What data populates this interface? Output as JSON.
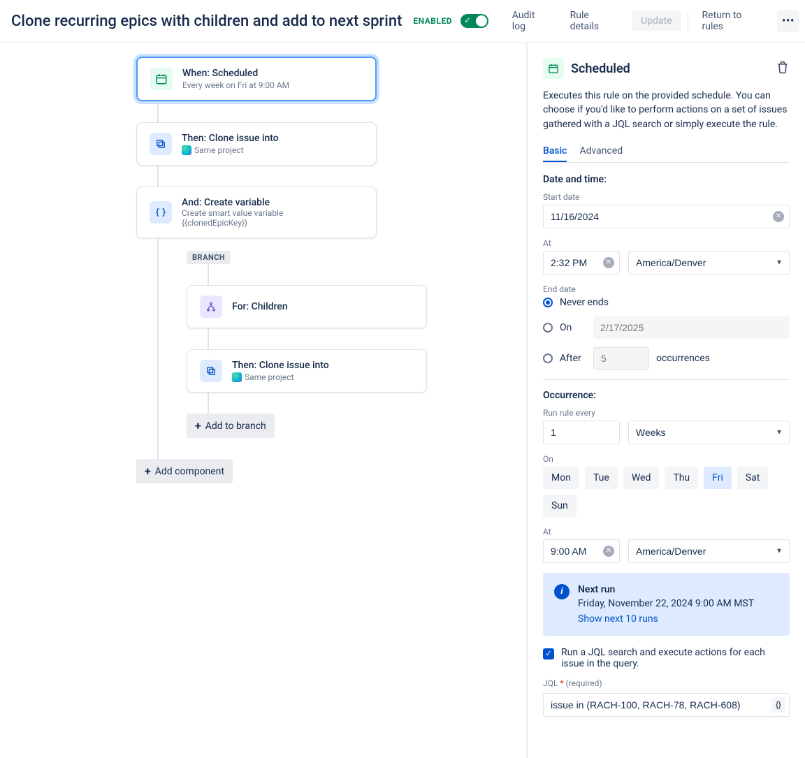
{
  "header": {
    "title": "Clone recurring epics with children and add to next sprint",
    "enabled_label": "ENABLED",
    "audit_log": "Audit log",
    "rule_details": "Rule details",
    "update": "Update",
    "return": "Return to rules",
    "more": "•••"
  },
  "nodes": {
    "trigger": {
      "title": "When: Scheduled",
      "sub": "Every week on Fri at 9:00 AM"
    },
    "clone1": {
      "title": "Then: Clone issue into",
      "sub": "Same project"
    },
    "var": {
      "title": "And: Create variable",
      "sub": "Create smart value variable",
      "sub2": "{{clonedEpicKey}}"
    },
    "branch_label": "BRANCH",
    "branch_for": {
      "title": "For: Children"
    },
    "clone2": {
      "title": "Then: Clone issue into",
      "sub": "Same project"
    },
    "add_branch": "Add to branch",
    "add_component": "Add component"
  },
  "panel": {
    "title": "Scheduled",
    "desc": "Executes this rule on the provided schedule. You can choose if you'd like to perform actions on a set of issues gathered with a JQL search or simply execute the rule.",
    "tabs": {
      "basic": "Basic",
      "advanced": "Advanced"
    },
    "datetime_heading": "Date and time:",
    "start_date_label": "Start date",
    "start_date_value": "11/16/2024",
    "at_label": "At",
    "time_value": "2:32 PM",
    "tz_value": "America/Denver",
    "end_date_label": "End date",
    "never_ends": "Never ends",
    "on_label": "On",
    "on_placeholder": "2/17/2025",
    "after_label": "After",
    "after_placeholder": "5",
    "occurrences_label": "occurrences",
    "occurrence_heading": "Occurrence:",
    "run_every_label": "Run rule every",
    "run_every_value": "1",
    "run_unit": "Weeks",
    "on_days_label": "On",
    "days": [
      "Mon",
      "Tue",
      "Wed",
      "Thu",
      "Fri",
      "Sat",
      "Sun"
    ],
    "selected_day_index": 4,
    "at2_label": "At",
    "time2_value": "9:00 AM",
    "tz2_value": "America/Denver",
    "next_run_heading": "Next run",
    "next_run_date": "Friday, November 22, 2024 9:00 AM MST",
    "show_next": "Show next 10 runs",
    "jql_cb_label": "Run a JQL search and execute actions for each issue in the query.",
    "jql_label": "JQL",
    "jql_required": "(required)",
    "jql_value": "issue in (RACH-100, RACH-78, RACH-608)",
    "jql_icon": "{}"
  }
}
